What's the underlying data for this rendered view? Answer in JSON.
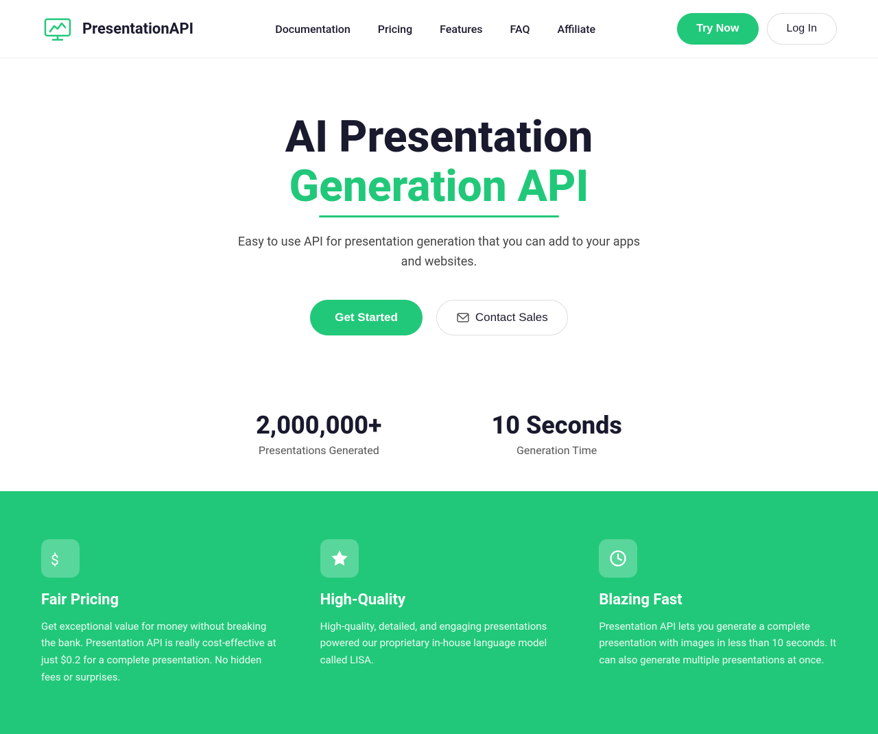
{
  "nav": {
    "logo_text": "Presentation",
    "logo_api": "API",
    "links": [
      {
        "label": "Documentation",
        "href": "#"
      },
      {
        "label": "Pricing",
        "href": "#"
      },
      {
        "label": "Features",
        "href": "#"
      },
      {
        "label": "FAQ",
        "href": "#"
      },
      {
        "label": "Affiliate",
        "href": "#"
      }
    ],
    "try_now": "Try Now",
    "login": "Log In"
  },
  "hero": {
    "title_black": "AI Presentation",
    "title_green": "Generation API",
    "subtitle": "Easy to use API for presentation generation that you can add to your apps and websites.",
    "get_started": "Get Started",
    "contact_sales": "Contact Sales"
  },
  "stats": [
    {
      "number": "2,000,000+",
      "label": "Presentations Generated"
    },
    {
      "number": "10 Seconds",
      "label": "Generation Time"
    }
  ],
  "features": [
    {
      "icon": "dollar",
      "title": "Fair Pricing",
      "desc": "Get exceptional value for money without breaking the bank. Presentation API is really cost-effective at just $0.2 for a complete presentation. No hidden fees or surprises."
    },
    {
      "icon": "star",
      "title": "High-Quality",
      "desc": "High-quality, detailed, and engaging presentations powered our proprietary in-house language model called LISA."
    },
    {
      "icon": "clock",
      "title": "Blazing Fast",
      "desc": "Presentation API lets you generate a complete presentation with images in less than 10 seconds. It can also generate multiple presentations at once."
    }
  ]
}
